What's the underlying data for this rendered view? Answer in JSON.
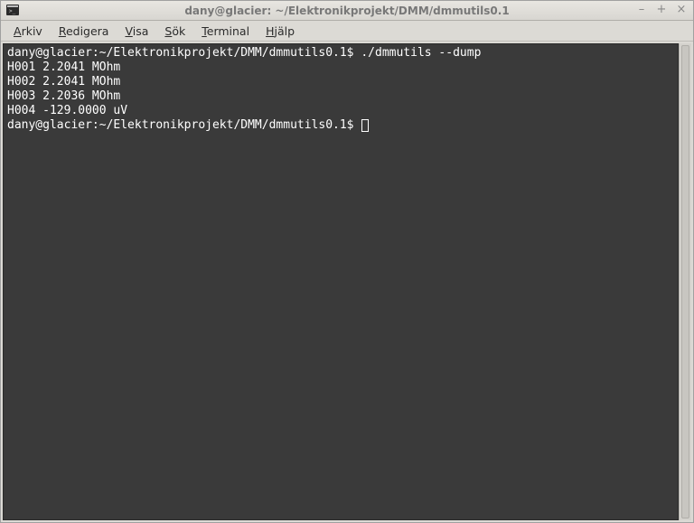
{
  "window": {
    "title": "dany@glacier: ~/Elektronikprojekt/DMM/dmmutils0.1",
    "controls": {
      "minimize": "–",
      "maximize": "+",
      "close": "×"
    }
  },
  "menubar": {
    "items": [
      {
        "underline": "A",
        "rest": "rkiv"
      },
      {
        "underline": "R",
        "rest": "edigera"
      },
      {
        "underline": "V",
        "rest": "isa"
      },
      {
        "underline": "S",
        "rest": "ök"
      },
      {
        "underline": "T",
        "rest": "erminal"
      },
      {
        "underline": "H",
        "rest": "jälp"
      }
    ]
  },
  "terminal": {
    "prompt": "dany@glacier:~/Elektronikprojekt/DMM/dmmutils0.1$",
    "command": "./dmmutils --dump",
    "output": [
      "H001 2.2041 MOhm",
      "H002 2.2041 MOhm",
      "H003 2.2036 MOhm",
      "H004 -129.0000 uV"
    ]
  }
}
